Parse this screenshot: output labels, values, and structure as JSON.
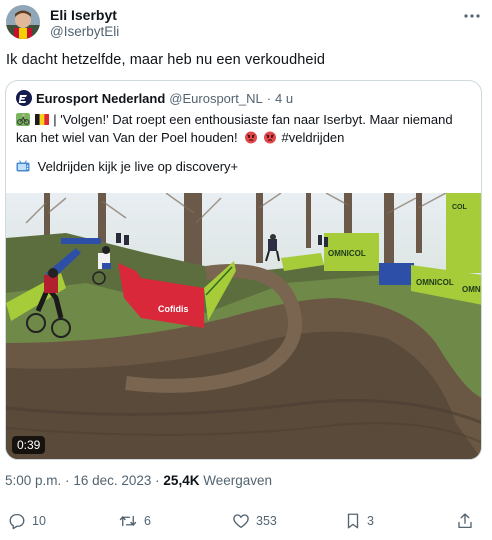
{
  "author": {
    "display_name": "Eli Iserbyt",
    "handle": "@IserbytEli"
  },
  "tweet_text": "Ik dacht hetzelfde, maar heb nu een verkoudheid",
  "quoted": {
    "display_name": "Eurosport Nederland",
    "handle": "@Eurosport_NL",
    "separator": "·",
    "time": "4 u",
    "line1": "| 'Volgen!' Dat roept een enthousiaste fan naar Iserbyt. Maar niemand",
    "line2_text": "kan het wiel van Van der Poel houden!",
    "hashtag": "#veldrijden",
    "promo": "Veldrijden kijk je live op discovery+",
    "video_duration": "0:39",
    "video_banners": {
      "left_banner": "Cofidis",
      "right_banner_1": "OMNICOL",
      "right_banner_2": "OMNICOL",
      "right_banner_3": "OMNICOL",
      "tall_panel": "COL"
    }
  },
  "meta": {
    "time": "5:00 p.m.",
    "separator": "·",
    "date": "16 dec. 2023",
    "separator2": "·",
    "views_count": "25,4K",
    "views_label": "Weergaven"
  },
  "actions": {
    "replies": "10",
    "reposts": "6",
    "likes": "353",
    "bookmarks": "3"
  },
  "colors": {
    "text": "#0f1419",
    "secondary": "#536471",
    "border": "#cfd9de",
    "banner_green": "#a7cc3a",
    "banner_red": "#d8283a"
  },
  "icons": [
    "avatar",
    "more-icon",
    "eurosport-logo",
    "bike-emoji",
    "belgium-flag-emoji",
    "angry-emoji",
    "tv-emoji",
    "reply-icon",
    "repost-icon",
    "like-icon",
    "bookmark-icon",
    "share-icon"
  ]
}
